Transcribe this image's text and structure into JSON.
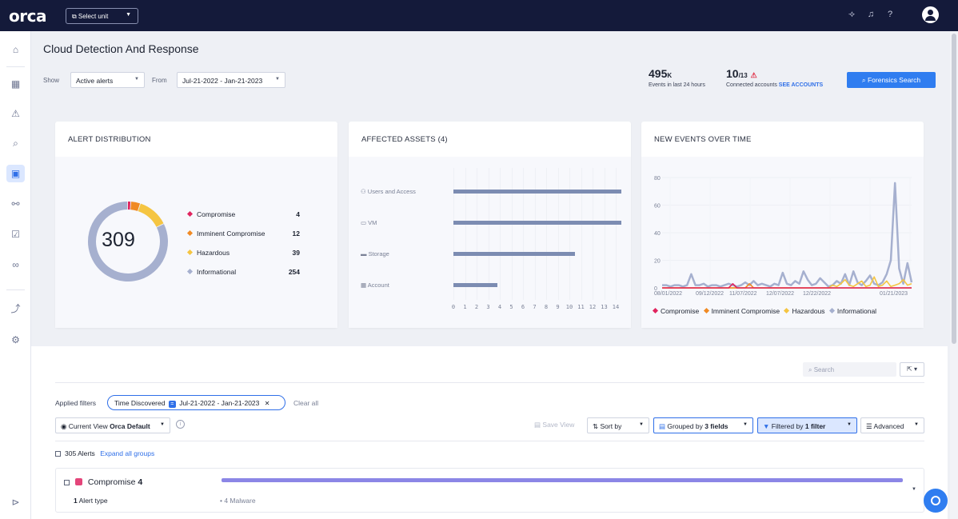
{
  "topbar": {
    "logo": "orca",
    "unit_select": "⧉ Select unit",
    "icons": [
      "megaphone-icon",
      "bell-icon",
      "help-icon",
      "user-avatar-icon"
    ]
  },
  "sidebar": {
    "items": [
      "dashboard-icon",
      "alert-icon",
      "search-icon",
      "cdr-icon",
      "graph-icon",
      "compliance-icon",
      "glasses-icon",
      "integrations-icon",
      "settings-icon"
    ],
    "active": "cdr-icon"
  },
  "header": {
    "title": "Cloud Detection And Response",
    "show_label": "Show",
    "show_value": "Active alerts",
    "from_label": "From",
    "date_range": "Jul-21-2022 - Jan-21-2023",
    "events_value": "495",
    "events_unit": "K",
    "events_caption": "Events in last 24 hours",
    "accounts_value": "10",
    "accounts_total": "/13",
    "accounts_caption": "Connected accounts",
    "see_accounts": "SEE ACCOUNTS",
    "forensics_button": "⌕ Forensics Search"
  },
  "alert_distribution": {
    "title": "ALERT DISTRIBUTION",
    "total": "309",
    "items": [
      {
        "label": "Compromise",
        "count": "4",
        "color": "#e0245e"
      },
      {
        "label": "Imminent Compromise",
        "count": "12",
        "color": "#f08a24"
      },
      {
        "label": "Hazardous",
        "count": "39",
        "color": "#f5c542"
      },
      {
        "label": "Informational",
        "count": "254",
        "color": "#a6b0cf"
      }
    ]
  },
  "affected_assets": {
    "title": "AFFECTED ASSETS (4)",
    "categories": [
      "Users and Access",
      "VM",
      "Storage",
      "Account"
    ],
    "icons": [
      "users-icon",
      "vm-icon",
      "storage-icon",
      "account-icon"
    ],
    "xticks": [
      "0",
      "1",
      "2",
      "3",
      "4",
      "5",
      "6",
      "7",
      "8",
      "9",
      "10",
      "11",
      "12",
      "13",
      "14"
    ]
  },
  "new_events": {
    "title": "NEW EVENTS OVER TIME",
    "yticks": [
      "0",
      "20",
      "40",
      "60",
      "80"
    ],
    "xticks": [
      "08/01/2022",
      "09/12/2022",
      "11/07/2022",
      "12/07/2022",
      "12/22/2022",
      "01/21/2023"
    ],
    "legend": [
      "Compromise",
      "Imminent Compromise",
      "Hazardous",
      "Informational"
    ]
  },
  "chart_data": [
    {
      "type": "pie",
      "title": "ALERT DISTRIBUTION",
      "categories": [
        "Compromise",
        "Imminent Compromise",
        "Hazardous",
        "Informational"
      ],
      "values": [
        4,
        12,
        39,
        254
      ],
      "colors": [
        "#e0245e",
        "#f08a24",
        "#f5c542",
        "#a6b0cf"
      ]
    },
    {
      "type": "bar",
      "title": "AFFECTED ASSETS (4)",
      "categories": [
        "Users and Access",
        "VM",
        "Storage",
        "Account"
      ],
      "values": [
        14.5,
        14.5,
        10.5,
        3.8
      ],
      "xlim": [
        0,
        14
      ],
      "orientation": "horizontal"
    },
    {
      "type": "line",
      "title": "NEW EVENTS OVER TIME",
      "ylim": [
        0,
        80
      ],
      "x": [
        "08/01/2022",
        "",
        "",
        "",
        "",
        "",
        "09/12/2022",
        "",
        "",
        "",
        "",
        "",
        "",
        "11/07/2022",
        "",
        "",
        "",
        "",
        "",
        "",
        "12/07/2022",
        "",
        "",
        "",
        "",
        "12/22/2022",
        "",
        "",
        "",
        "",
        "",
        "",
        "",
        "",
        "",
        "",
        "",
        "",
        "",
        "",
        "",
        "",
        "",
        "",
        "",
        "",
        "",
        "",
        "",
        "",
        "",
        "01/21/2023"
      ],
      "series": [
        {
          "name": "Informational",
          "color": "#a6b0cf",
          "values": [
            2,
            2,
            1,
            2,
            2,
            1,
            2,
            10,
            2,
            2,
            3,
            1,
            2,
            2,
            1,
            2,
            3,
            2,
            1,
            2,
            4,
            2,
            5,
            2,
            3,
            2,
            1,
            3,
            2,
            11,
            3,
            2,
            5,
            3,
            12,
            6,
            2,
            3,
            7,
            4,
            1,
            2,
            5,
            3,
            10,
            2,
            12,
            4,
            2,
            5,
            9,
            3,
            2,
            4,
            10,
            20,
            76,
            14,
            3,
            18,
            4
          ]
        },
        {
          "name": "Hazardous",
          "color": "#f5c542",
          "values": [
            0,
            0,
            0,
            0,
            0,
            0,
            0,
            0,
            0,
            0,
            0,
            0,
            0,
            0,
            0,
            0,
            0,
            0,
            0,
            0,
            0,
            0,
            0,
            0,
            0,
            0,
            0,
            0,
            0,
            0,
            0,
            0,
            0,
            0,
            0,
            0,
            0,
            0,
            0,
            0,
            0,
            2,
            1,
            3,
            6,
            2,
            1,
            3,
            5,
            1,
            2,
            8,
            1,
            2,
            5,
            1,
            2,
            3,
            6,
            2,
            3
          ]
        },
        {
          "name": "Imminent Compromise",
          "color": "#f08a24",
          "values": [
            0,
            0,
            0,
            0,
            0,
            0,
            0,
            0,
            0,
            0,
            0,
            0,
            0,
            0,
            0,
            0,
            0,
            0,
            0,
            0,
            0,
            3,
            0,
            0,
            0,
            0,
            0,
            0,
            0,
            0,
            0,
            0,
            0,
            0,
            0,
            0,
            0,
            0,
            0,
            0,
            0,
            0,
            0,
            0,
            0,
            0,
            0,
            0,
            0,
            0,
            0,
            0,
            0,
            0,
            0,
            0,
            0,
            0,
            0,
            0,
            0
          ]
        },
        {
          "name": "Compromise",
          "color": "#e0245e",
          "values": [
            0,
            0,
            0,
            0,
            0,
            0,
            0,
            0,
            0,
            0,
            0,
            0,
            0,
            0,
            0,
            0,
            0,
            3,
            0,
            0,
            0,
            0,
            0,
            0,
            0,
            0,
            0,
            0,
            0,
            0,
            0,
            0,
            0,
            0,
            0,
            0,
            0,
            0,
            0,
            0,
            0,
            0,
            0,
            0,
            0,
            0,
            0,
            0,
            0,
            0,
            0,
            0,
            0,
            0,
            0,
            0,
            0,
            0,
            0,
            0,
            0
          ]
        }
      ]
    }
  ],
  "alerts_panel": {
    "search_placeholder": "⌕ Search",
    "applied_filters_label": "Applied filters",
    "chip_field": "Time Discovered",
    "chip_op": "=",
    "chip_value": "Jul-21-2022 - Jan-21-2023",
    "chip_close": "✕",
    "clear_all": "Clear all",
    "current_view_label": "◉ Current View",
    "current_view_value": "Orca Default",
    "save_view": "Save View",
    "sort_by": "⇅ Sort by",
    "grouped_by_prefix": "Grouped by",
    "grouped_by_value": "3 fields",
    "filtered_by_prefix": "Filtered by",
    "filtered_by_value": "1 filter",
    "advanced": "Advanced",
    "alerts_count": "305 Alerts",
    "expand_all": "Expand all groups",
    "group_name": "Compromise",
    "group_count": "4",
    "alert_type_count": "1",
    "alert_type_label": "Alert type",
    "malware": "• 4 Malware"
  }
}
